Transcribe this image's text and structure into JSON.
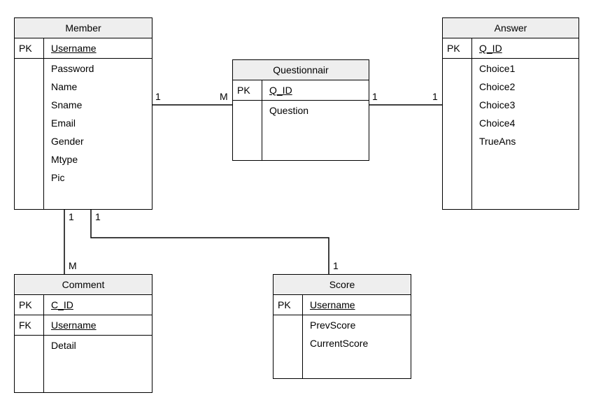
{
  "entities": {
    "member": {
      "title": "Member",
      "pk_label": "PK",
      "pk_attr": "Username",
      "attrs": [
        "Password",
        "Name",
        "Sname",
        "Email",
        "Gender",
        "Mtype",
        "Pic"
      ]
    },
    "questionnair": {
      "title": "Questionnair",
      "pk_label": "PK",
      "pk_attr": "Q_ID",
      "attrs": [
        "Question"
      ]
    },
    "answer": {
      "title": "Answer",
      "pk_label": "PK",
      "pk_attr": "Q_ID",
      "attrs": [
        "Choice1",
        "Choice2",
        "Choice3",
        "Choice4",
        "TrueAns"
      ]
    },
    "comment": {
      "title": "Comment",
      "pk_label": "PK",
      "pk_attr": "C_ID",
      "fk_label": "FK",
      "fk_attr": "Username",
      "attrs": [
        "Detail"
      ]
    },
    "score": {
      "title": "Score",
      "pk_label": "PK",
      "pk_attr": "Username",
      "attrs": [
        "PrevScore",
        "CurrentScore"
      ]
    }
  },
  "cardinalities": {
    "member_q_left": "1",
    "member_q_right": "M",
    "q_answer_left": "1",
    "q_answer_right": "1",
    "member_comment_top": "1",
    "member_comment_bottom": "M",
    "member_score_top": "1",
    "member_score_bottom": "1"
  }
}
